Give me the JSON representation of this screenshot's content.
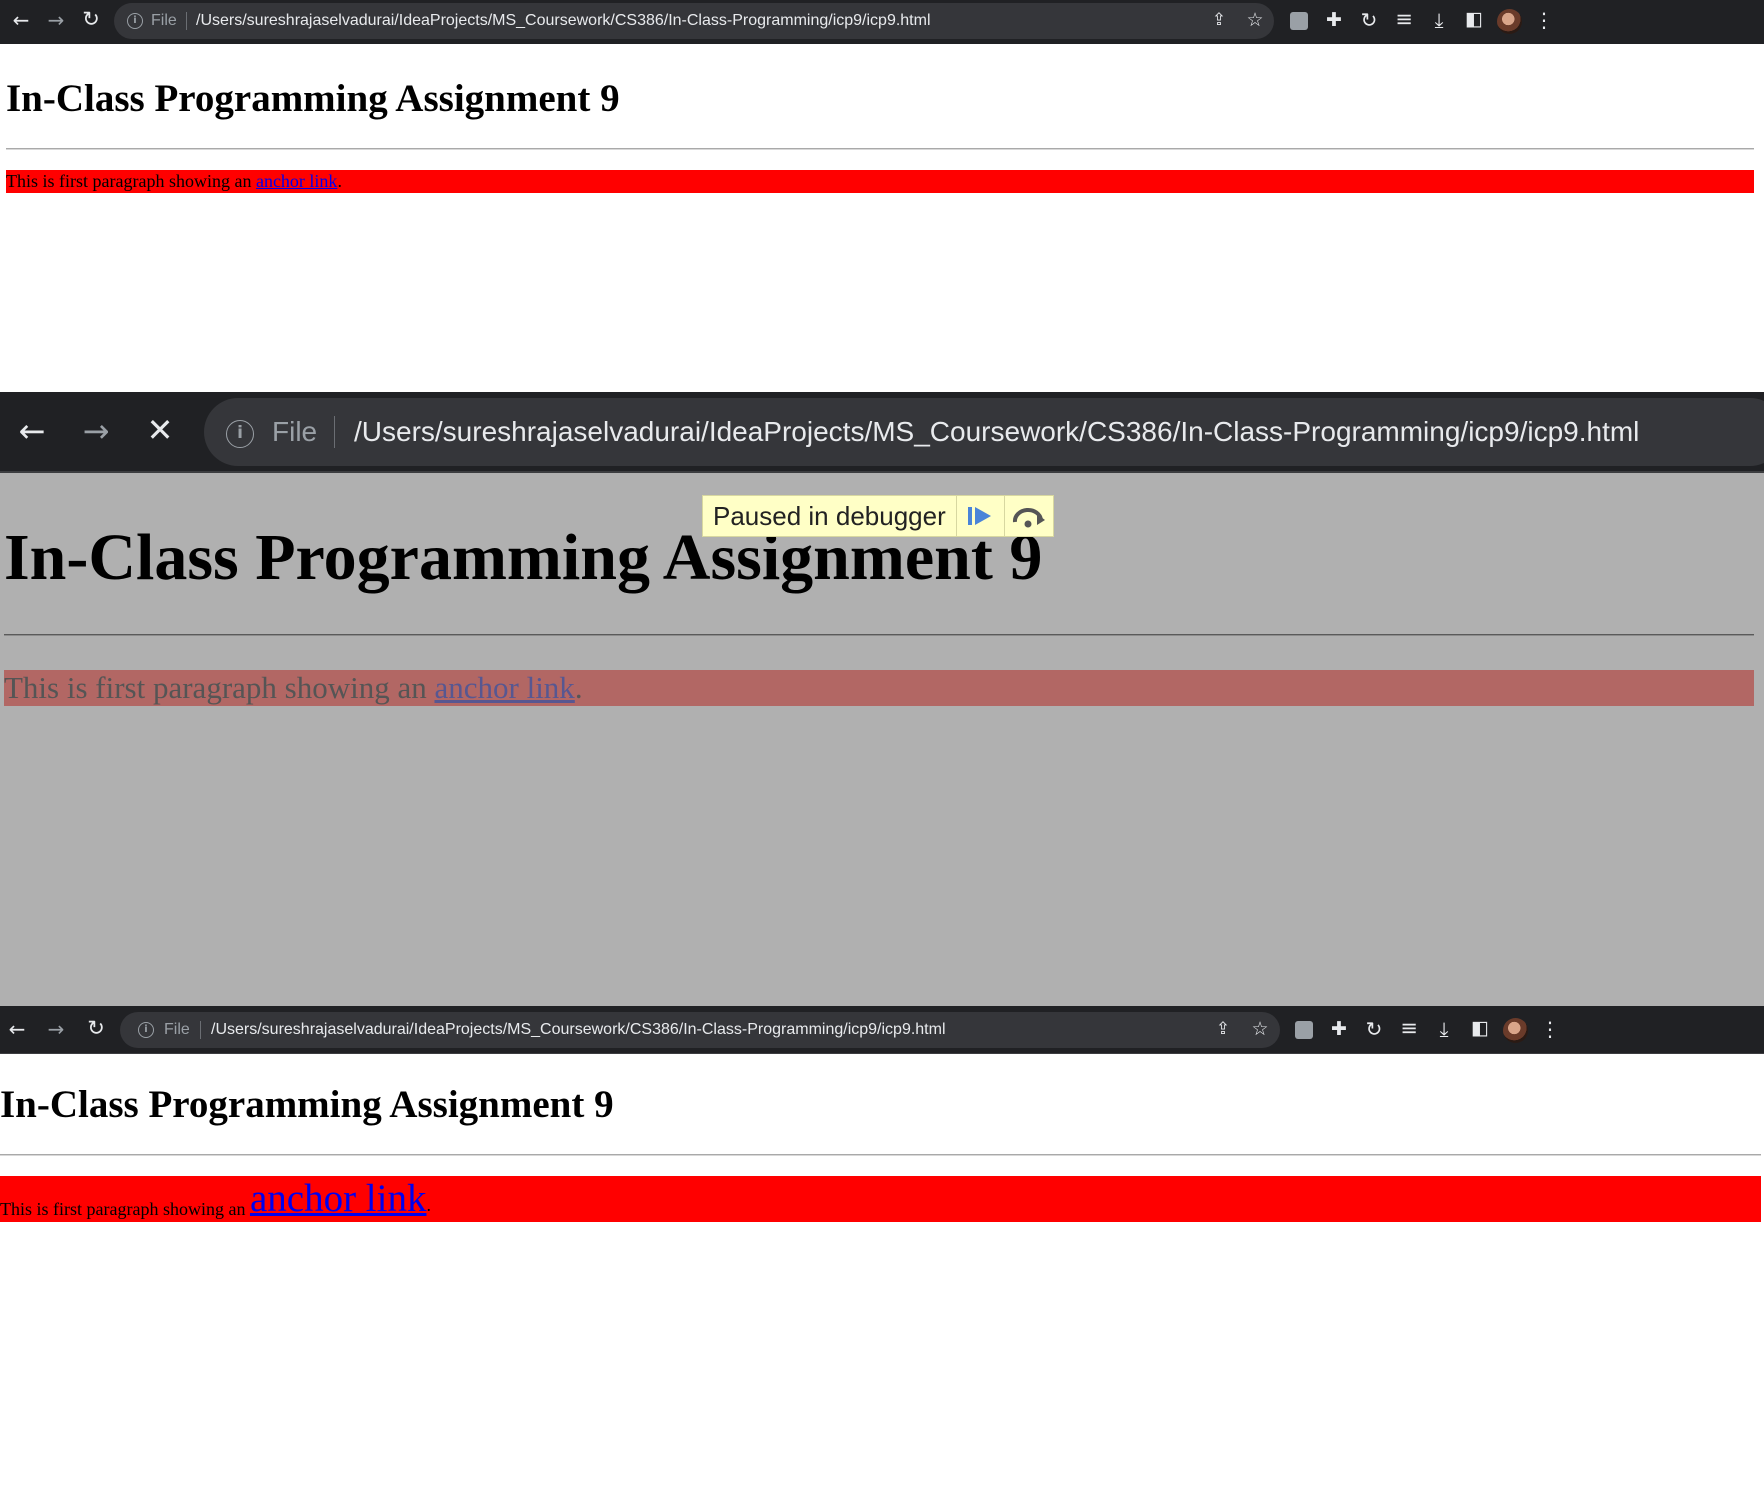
{
  "browser": {
    "scheme_label": "File",
    "url": "/Users/sureshrajaselvadurai/IdeaProjects/MS_Coursework/CS386/In-Class-Programming/icp9/icp9.html"
  },
  "page": {
    "heading": "In-Class Programming Assignment 9",
    "paragraph_text": "This is first paragraph showing an ",
    "link_text": "anchor link",
    "paragraph_end": "."
  },
  "debugger": {
    "label": "Paused in debugger"
  },
  "icons": {
    "back": "←",
    "forward": "→",
    "reload": "↻",
    "stop": "✕",
    "info": "i",
    "share": "⇪",
    "star": "☆",
    "puzzle": "✚",
    "sync": "↻",
    "media": "≡",
    "download": "⤓",
    "sidepanel": "◧",
    "menu": "⋮"
  },
  "colors": {
    "toolbar_bg": "#202124",
    "omnibox_bg": "#35363a",
    "paragraph_bg": "#ff0000",
    "overlay_bg": "#b0b0b0",
    "debugger_bg": "#ffffc6",
    "link": "#0000ee"
  }
}
